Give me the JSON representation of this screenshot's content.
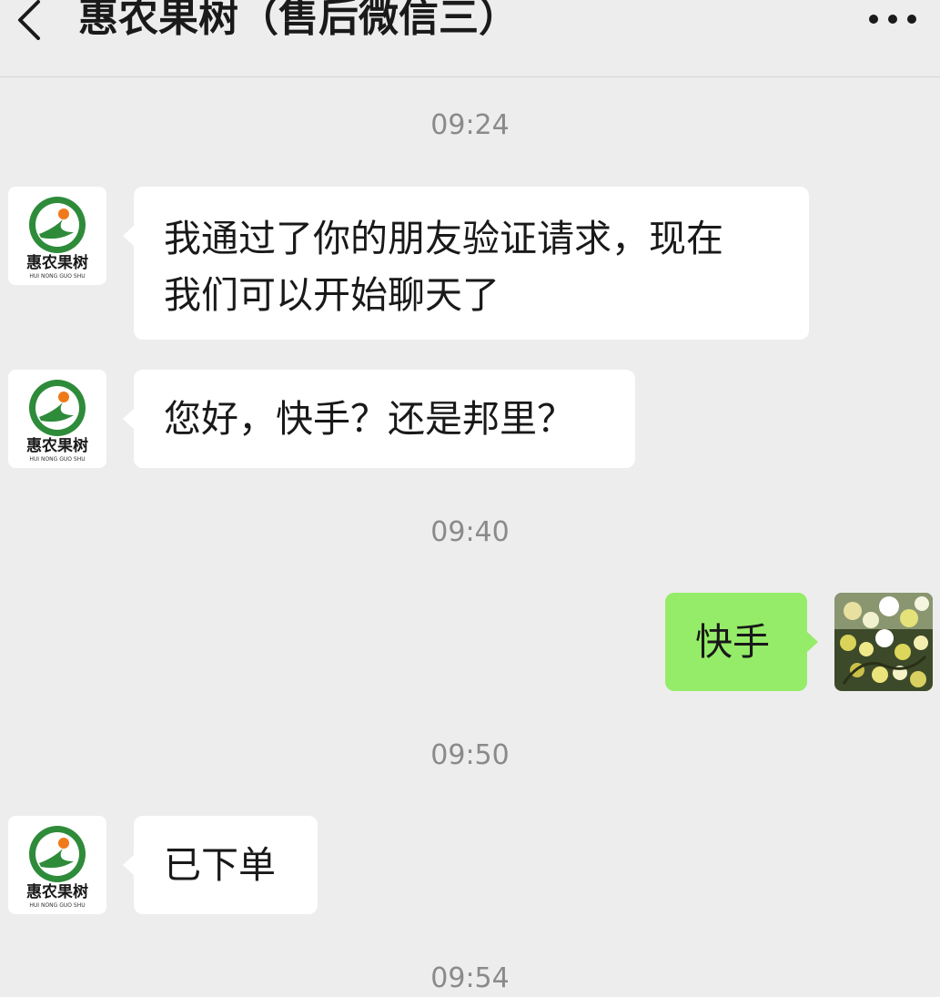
{
  "header": {
    "title": "惠农果树（售后微信三）",
    "back_icon": "chevron-left-icon",
    "more_icon": "more-dots-icon"
  },
  "contact_logo": {
    "name_cn": "惠农果树",
    "name_pinyin": "HUI NONG GUO SHU",
    "colors": {
      "green": "#2e8b3a",
      "orange": "#f07a1a"
    }
  },
  "messages": [
    {
      "type": "time",
      "text": "09:24"
    },
    {
      "type": "incoming",
      "text_lines": [
        "我通过了你的朋友验证请求，现在",
        "我们可以开始聊天了"
      ]
    },
    {
      "type": "incoming",
      "text_lines": [
        "您好，快手？还是邦里？"
      ]
    },
    {
      "type": "time",
      "text": "09:40"
    },
    {
      "type": "outgoing",
      "text_lines": [
        "快手"
      ],
      "avatar": "flower-photo"
    },
    {
      "type": "time",
      "text": "09:50"
    },
    {
      "type": "incoming",
      "text_lines": [
        "已下单"
      ]
    },
    {
      "type": "time",
      "text": "09:54"
    }
  ],
  "colors": {
    "background": "#ededed",
    "incoming_bubble": "#ffffff",
    "outgoing_bubble": "#95ec69",
    "timestamp": "#8a8a8a"
  }
}
